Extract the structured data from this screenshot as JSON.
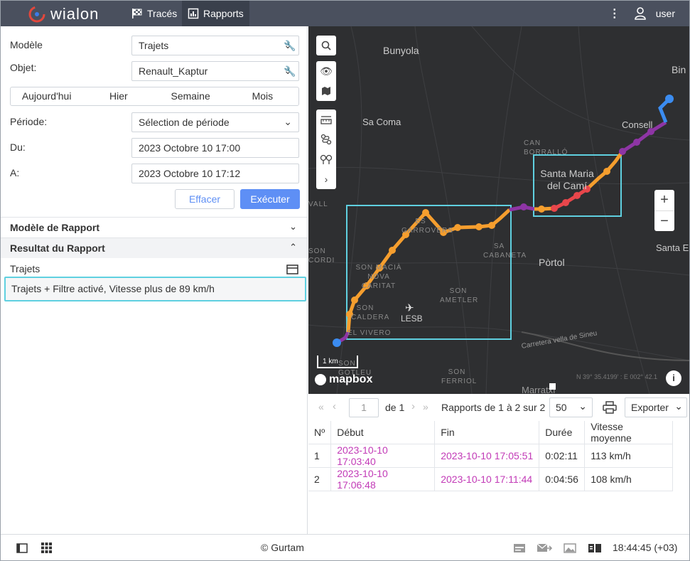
{
  "header": {
    "logo_text": "wialon",
    "tabs": [
      {
        "label": "Tracés",
        "icon": "checkered-flag-icon"
      },
      {
        "label": "Rapports",
        "icon": "report-chart-icon"
      }
    ],
    "user": "user"
  },
  "form": {
    "model_label": "Modèle",
    "model_value": "Trajets",
    "object_label": "Objet:",
    "object_value": "Renault_Kaptur",
    "quick_periods": [
      "Aujourd'hui",
      "Hier",
      "Semaine",
      "Mois"
    ],
    "period_label": "Période:",
    "period_value": "Sélection de période",
    "from_label": "Du:",
    "from_value": "2023 Octobre 10 17:00",
    "to_label": "A:",
    "to_value": "2023 Octobre 10 17:12",
    "clear_label": "Effacer",
    "execute_label": "Exécuter"
  },
  "sections": {
    "report_template": "Modèle de Rapport",
    "report_result": "Resultat du Rapport",
    "result_table_label": "Trajets",
    "result_item": "Trajets + Filtre activé, Vitesse plus de 89 km/h"
  },
  "map": {
    "places": [
      "Bunyola",
      "Sa Coma",
      "Consell",
      "Bin",
      "CAN BORRALLÓ",
      "Santa Maria del Camí",
      "ES GARROVERS",
      "SA CABANETA",
      "Pòrtol",
      "Santa E",
      "SON MACIÀ NOVA CARITAT",
      "SON AMETLER",
      "LESB",
      "SON CALDERA",
      "EL VIVERO",
      "SON GOTLEU",
      "SON FERRIOL",
      "VALL DE SON",
      "SON CORDINA",
      "Carretera vella de Sineu",
      "Marratxí"
    ],
    "scale_label": "1 km",
    "brand": "mapbox",
    "coords": "N 39° 35.4199' : E 002° 42.1"
  },
  "pager": {
    "page": "1",
    "of_label": "de 1",
    "summary": "Rapports de 1 à 2 sur 2",
    "page_size": "50",
    "export_label": "Exporter"
  },
  "table": {
    "headers": [
      "Nº",
      "Début",
      "Fin",
      "Durée",
      "Vitesse moyenne"
    ],
    "rows": [
      [
        "1",
        "2023-10-10 17:03:40",
        "2023-10-10 17:05:51",
        "0:02:11",
        "113 km/h"
      ],
      [
        "2",
        "2023-10-10 17:06:48",
        "2023-10-10 17:11:44",
        "0:04:56",
        "108 km/h"
      ]
    ]
  },
  "footer": {
    "copyright": "© Gurtam",
    "time": "18:44:45 (+03)"
  },
  "colors": {
    "accent": "#5e8ff5",
    "track_orange": "#f59e2e",
    "track_purple": "#8e35a5",
    "track_red": "#e8464b",
    "track_blue": "#3b8cf0",
    "highlight_box": "#5fd0e0",
    "link": "#c23ab7"
  }
}
